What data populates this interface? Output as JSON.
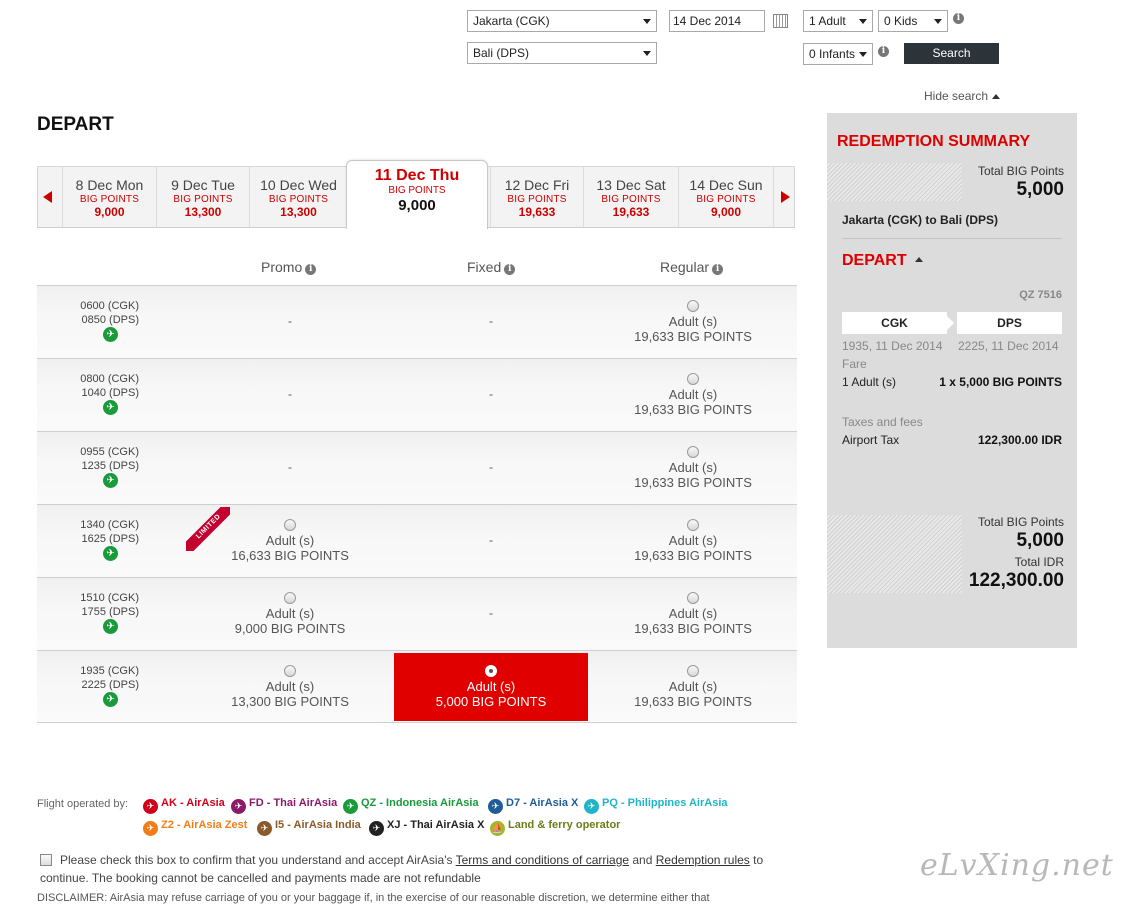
{
  "search": {
    "origin": "Jakarta (CGK)",
    "destination": "Bali (DPS)",
    "date": "14 Dec 2014",
    "adults": "1 Adult",
    "kids": "0 Kids",
    "infants": "0 Infants",
    "search_label": "Search",
    "hide_search_label": "Hide search"
  },
  "depart": {
    "title": "DEPART",
    "dates": [
      {
        "label": "8 Dec Mon",
        "points_label": "BIG POINTS",
        "value": "9,000"
      },
      {
        "label": "9 Dec Tue",
        "points_label": "BIG POINTS",
        "value": "13,300"
      },
      {
        "label": "10 Dec Wed",
        "points_label": "BIG POINTS",
        "value": "13,300"
      },
      {
        "label": "11 Dec Thu",
        "points_label": "BIG POINTS",
        "value": "9,000"
      },
      {
        "label": "12 Dec Fri",
        "points_label": "BIG POINTS",
        "value": "19,633"
      },
      {
        "label": "13 Dec Sat",
        "points_label": "BIG POINTS",
        "value": "19,633"
      },
      {
        "label": "14 Dec Sun",
        "points_label": "BIG POINTS",
        "value": "9,000"
      }
    ],
    "columns": [
      "Promo",
      "Fixed",
      "Regular"
    ],
    "limited_label": "LIMITED",
    "flights": [
      {
        "dep": "0600 (CGK)",
        "arr": "0850 (DPS)",
        "promo": null,
        "fixed": null,
        "regular": {
          "pax": "Adult (s)",
          "points": "19,633 BIG POINTS"
        }
      },
      {
        "dep": "0800 (CGK)",
        "arr": "1040 (DPS)",
        "promo": null,
        "fixed": null,
        "regular": {
          "pax": "Adult (s)",
          "points": "19,633 BIG POINTS"
        }
      },
      {
        "dep": "0955 (CGK)",
        "arr": "1235 (DPS)",
        "promo": null,
        "fixed": null,
        "regular": {
          "pax": "Adult (s)",
          "points": "19,633 BIG POINTS"
        }
      },
      {
        "dep": "1340 (CGK)",
        "arr": "1625 (DPS)",
        "promo": {
          "pax": "Adult (s)",
          "points": "16,633 BIG POINTS"
        },
        "fixed": null,
        "regular": {
          "pax": "Adult (s)",
          "points": "19,633 BIG POINTS"
        }
      },
      {
        "dep": "1510 (CGK)",
        "arr": "1755 (DPS)",
        "promo": {
          "pax": "Adult (s)",
          "points": "9,000 BIG POINTS"
        },
        "fixed": null,
        "regular": {
          "pax": "Adult (s)",
          "points": "19,633 BIG POINTS"
        }
      },
      {
        "dep": "1935 (CGK)",
        "arr": "2225 (DPS)",
        "promo": {
          "pax": "Adult (s)",
          "points": "13,300 BIG POINTS"
        },
        "fixed": {
          "pax": "Adult (s)",
          "points": "5,000 BIG POINTS"
        },
        "regular": {
          "pax": "Adult (s)",
          "points": "19,633 BIG POINTS"
        }
      }
    ],
    "empty_marker": "-"
  },
  "summary": {
    "title": "REDEMPTION SUMMARY",
    "total_big_points_label": "Total BIG Points",
    "total_big_points": "5,000",
    "route": "Jakarta (CGK) to Bali (DPS)",
    "depart_label": "DEPART",
    "flight_no": "QZ 7516",
    "from_code": "CGK",
    "to_code": "DPS",
    "from_time": "1935, 11 Dec 2014",
    "to_time": "2225, 11 Dec 2014",
    "fare_label": "Fare",
    "fare_pax": "1 Adult (s)",
    "fare_value": "1 x 5,000 BIG POINTS",
    "taxes_label": "Taxes and fees",
    "airport_tax_label": "Airport Tax",
    "airport_tax_value": "122,300.00 IDR",
    "bottom_points_label": "Total BIG Points",
    "bottom_points": "5,000",
    "total_idr_label": "Total IDR",
    "total_idr": "122,300.00"
  },
  "footer": {
    "operated_by_label": "Flight operated by:",
    "operators": [
      {
        "text": "AK - AirAsia",
        "color": "#d0021b"
      },
      {
        "text": "FD - Thai AirAsia",
        "color": "#8b1a6b"
      },
      {
        "text": "QZ - Indonesia AirAsia",
        "color": "#1a9a3b"
      },
      {
        "text": "D7 - AirAsia X",
        "color": "#1f5c99"
      },
      {
        "text": "PQ - Philippines AirAsia",
        "color": "#1fb5c9"
      },
      {
        "text": "Z2 - AirAsia Zest",
        "color": "#f07d1a"
      },
      {
        "text": "I5 - AirAsia India",
        "color": "#8a5a2b"
      },
      {
        "text": "XJ - Thai AirAsia X",
        "color": "#222222"
      },
      {
        "text": "Land & ferry operator",
        "color": "#6b7d1a"
      }
    ],
    "confirm_text_1": "Please check this box to confirm that you understand and accept AirAsia's ",
    "terms_link": "Terms and conditions of carriage",
    "confirm_and": " and ",
    "rules_link": "Redemption rules",
    "confirm_text_2": " to continue. The booking cannot be cancelled and payments made are not refundable",
    "disclaimer": "DISCLAIMER: AirAsia may refuse carriage of you or your baggage if, in the exercise of our reasonable discretion, we determine either that",
    "watermark": "eLvXing.net"
  }
}
